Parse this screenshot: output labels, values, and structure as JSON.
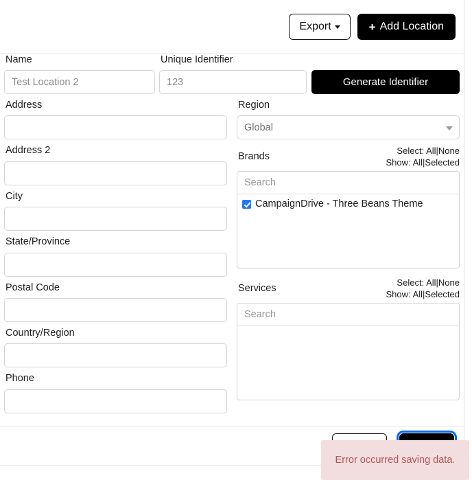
{
  "toolbar": {
    "export_label": "Export",
    "export_icon": "caret-down-icon",
    "add_label": "Add Location",
    "add_icon": "plus-icon"
  },
  "form": {
    "name": {
      "label": "Name",
      "placeholder": "Test Location 2",
      "value": ""
    },
    "unique_identifier": {
      "label": "Unique Identifier",
      "placeholder": "123",
      "value": ""
    },
    "generate_identifier_label": "Generate Identifier",
    "address": {
      "label": "Address",
      "value": "",
      "placeholder": ""
    },
    "address2": {
      "label": "Address 2",
      "value": "",
      "placeholder": ""
    },
    "city": {
      "label": "City",
      "value": "",
      "placeholder": ""
    },
    "state": {
      "label": "State/Province",
      "value": "",
      "placeholder": ""
    },
    "postal_code": {
      "label": "Postal Code",
      "value": "",
      "placeholder": ""
    },
    "country": {
      "label": "Country/Region",
      "value": "",
      "placeholder": ""
    },
    "phone": {
      "label": "Phone",
      "value": "",
      "placeholder": ""
    },
    "region": {
      "label": "Region",
      "selected": "Global",
      "options": [
        "Global"
      ]
    },
    "brands": {
      "label": "Brands",
      "select_prefix": "Select:",
      "select_all": "All",
      "select_none": "None",
      "show_prefix": "Show:",
      "show_all": "All",
      "show_selected": "Selected",
      "separator": "|",
      "search_placeholder": "Search",
      "search_value": "",
      "items": [
        {
          "label": "CampaignDrive - Three Beans Theme",
          "checked": true
        }
      ]
    },
    "services": {
      "label": "Services",
      "select_prefix": "Select:",
      "select_all": "All",
      "select_none": "None",
      "show_prefix": "Show:",
      "show_all": "All",
      "show_selected": "Selected",
      "separator": "|",
      "search_placeholder": "Search",
      "search_value": "",
      "items": []
    }
  },
  "footer": {
    "cancel_label": "",
    "save_label": ""
  },
  "toast": {
    "message": "Error occurred saving data.",
    "background": "#f2dede",
    "text_color": "#b05459"
  },
  "colors": {
    "primary": "#000000",
    "accent": "#2176ff",
    "focus_ring": "#0a68f0",
    "border": "#d4d4d4",
    "divider": "#e2e2e2"
  }
}
